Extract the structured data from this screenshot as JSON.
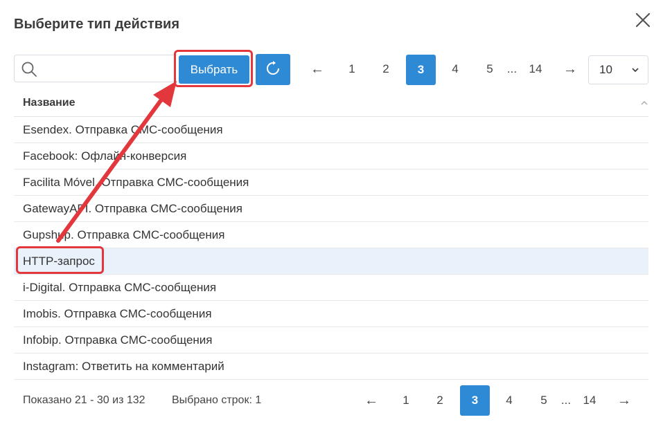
{
  "dialog": {
    "title": "Выберите тип действия"
  },
  "toolbar": {
    "search_placeholder": "",
    "search_value": "",
    "select_label": "Выбрать"
  },
  "pagination_top": {
    "prev": "←",
    "pages": [
      "1",
      "2",
      "3",
      "4",
      "5"
    ],
    "active": "3",
    "ellipsis": "...",
    "last": "14",
    "next": "→"
  },
  "page_size": {
    "value": "10"
  },
  "table": {
    "header": "Название",
    "rows": [
      "Esendex. Отправка СМС-сообщения",
      "Facebook: Офлайн-конверсия",
      "Facilita Móvel. Отправка СМС-сообщения",
      "GatewayAPI. Отправка СМС-сообщения",
      "Gupshup. Отправка СМС-сообщения",
      "HTTP-запрос",
      "i-Digital. Отправка СМС-сообщения",
      "Imobis. Отправка СМС-сообщения",
      "Infobip. Отправка СМС-сообщения",
      "Instagram: Ответить на комментарий"
    ],
    "selected_index": 5
  },
  "footer": {
    "shown": "Показано 21 - 30 из 132",
    "selected": "Выбрано строк: 1",
    "pagination": {
      "prev": "←",
      "pages": [
        "1",
        "2",
        "3",
        "4",
        "5"
      ],
      "active": "3",
      "ellipsis": "...",
      "last": "14",
      "next": "→"
    }
  },
  "colors": {
    "accent": "#2f8ad6",
    "highlight": "#e2373d",
    "selected_row": "#e9f1fb"
  },
  "icons": {
    "close": "close-icon",
    "search": "search-icon",
    "refresh": "refresh-icon",
    "dropdown": "chevron-down-icon",
    "sort": "sort-asc-icon"
  }
}
